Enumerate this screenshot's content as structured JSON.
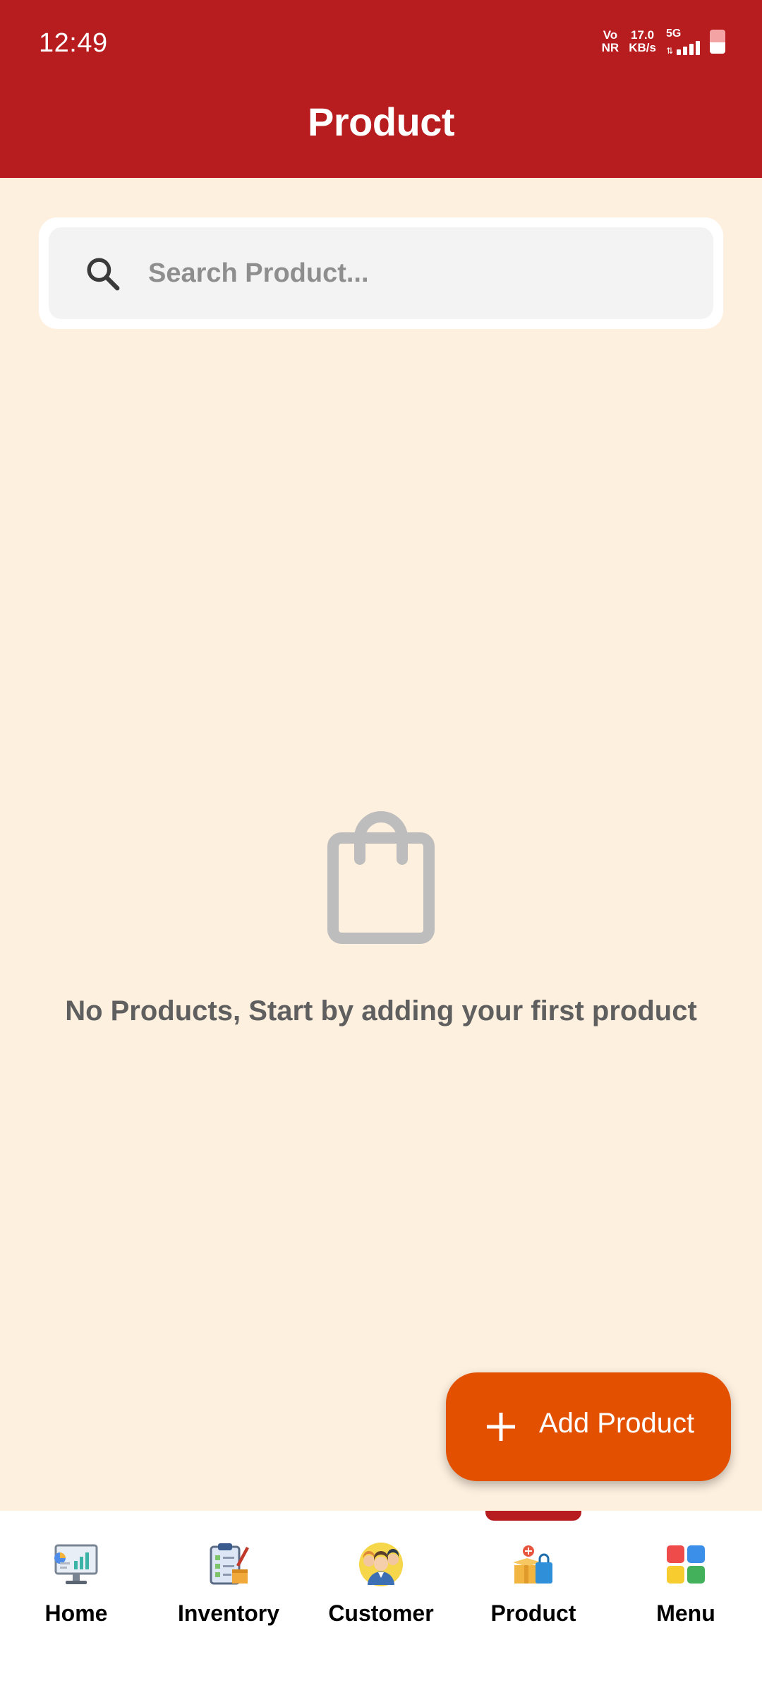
{
  "status_bar": {
    "time": "12:49",
    "volte_top": "Vo",
    "volte_bottom": "NR",
    "speed_value": "17.0",
    "speed_unit": "KB/s",
    "network": "5G",
    "battery_level": 0.48
  },
  "header": {
    "title": "Product",
    "background_color": "#B71C1F"
  },
  "search": {
    "placeholder": "Search Product...",
    "value": "",
    "icon": "search-icon"
  },
  "empty_state": {
    "icon": "shopping-bag-icon",
    "message": "No Products, Start by adding your first product"
  },
  "fab": {
    "label": "Add Product",
    "icon": "plus-icon",
    "color": "#E35100"
  },
  "bottom_nav": {
    "active_index": 3,
    "items": [
      {
        "label": "Home",
        "icon": "home-dashboard-icon"
      },
      {
        "label": "Inventory",
        "icon": "inventory-checklist-icon"
      },
      {
        "label": "Customer",
        "icon": "customer-people-icon"
      },
      {
        "label": "Product",
        "icon": "product-box-icon"
      },
      {
        "label": "Menu",
        "icon": "menu-grid-icon"
      }
    ]
  },
  "colors": {
    "page_background": "#FEF0DF",
    "accent": "#B71C1F",
    "fab": "#E35100",
    "empty_icon": "#BDBDBD"
  }
}
